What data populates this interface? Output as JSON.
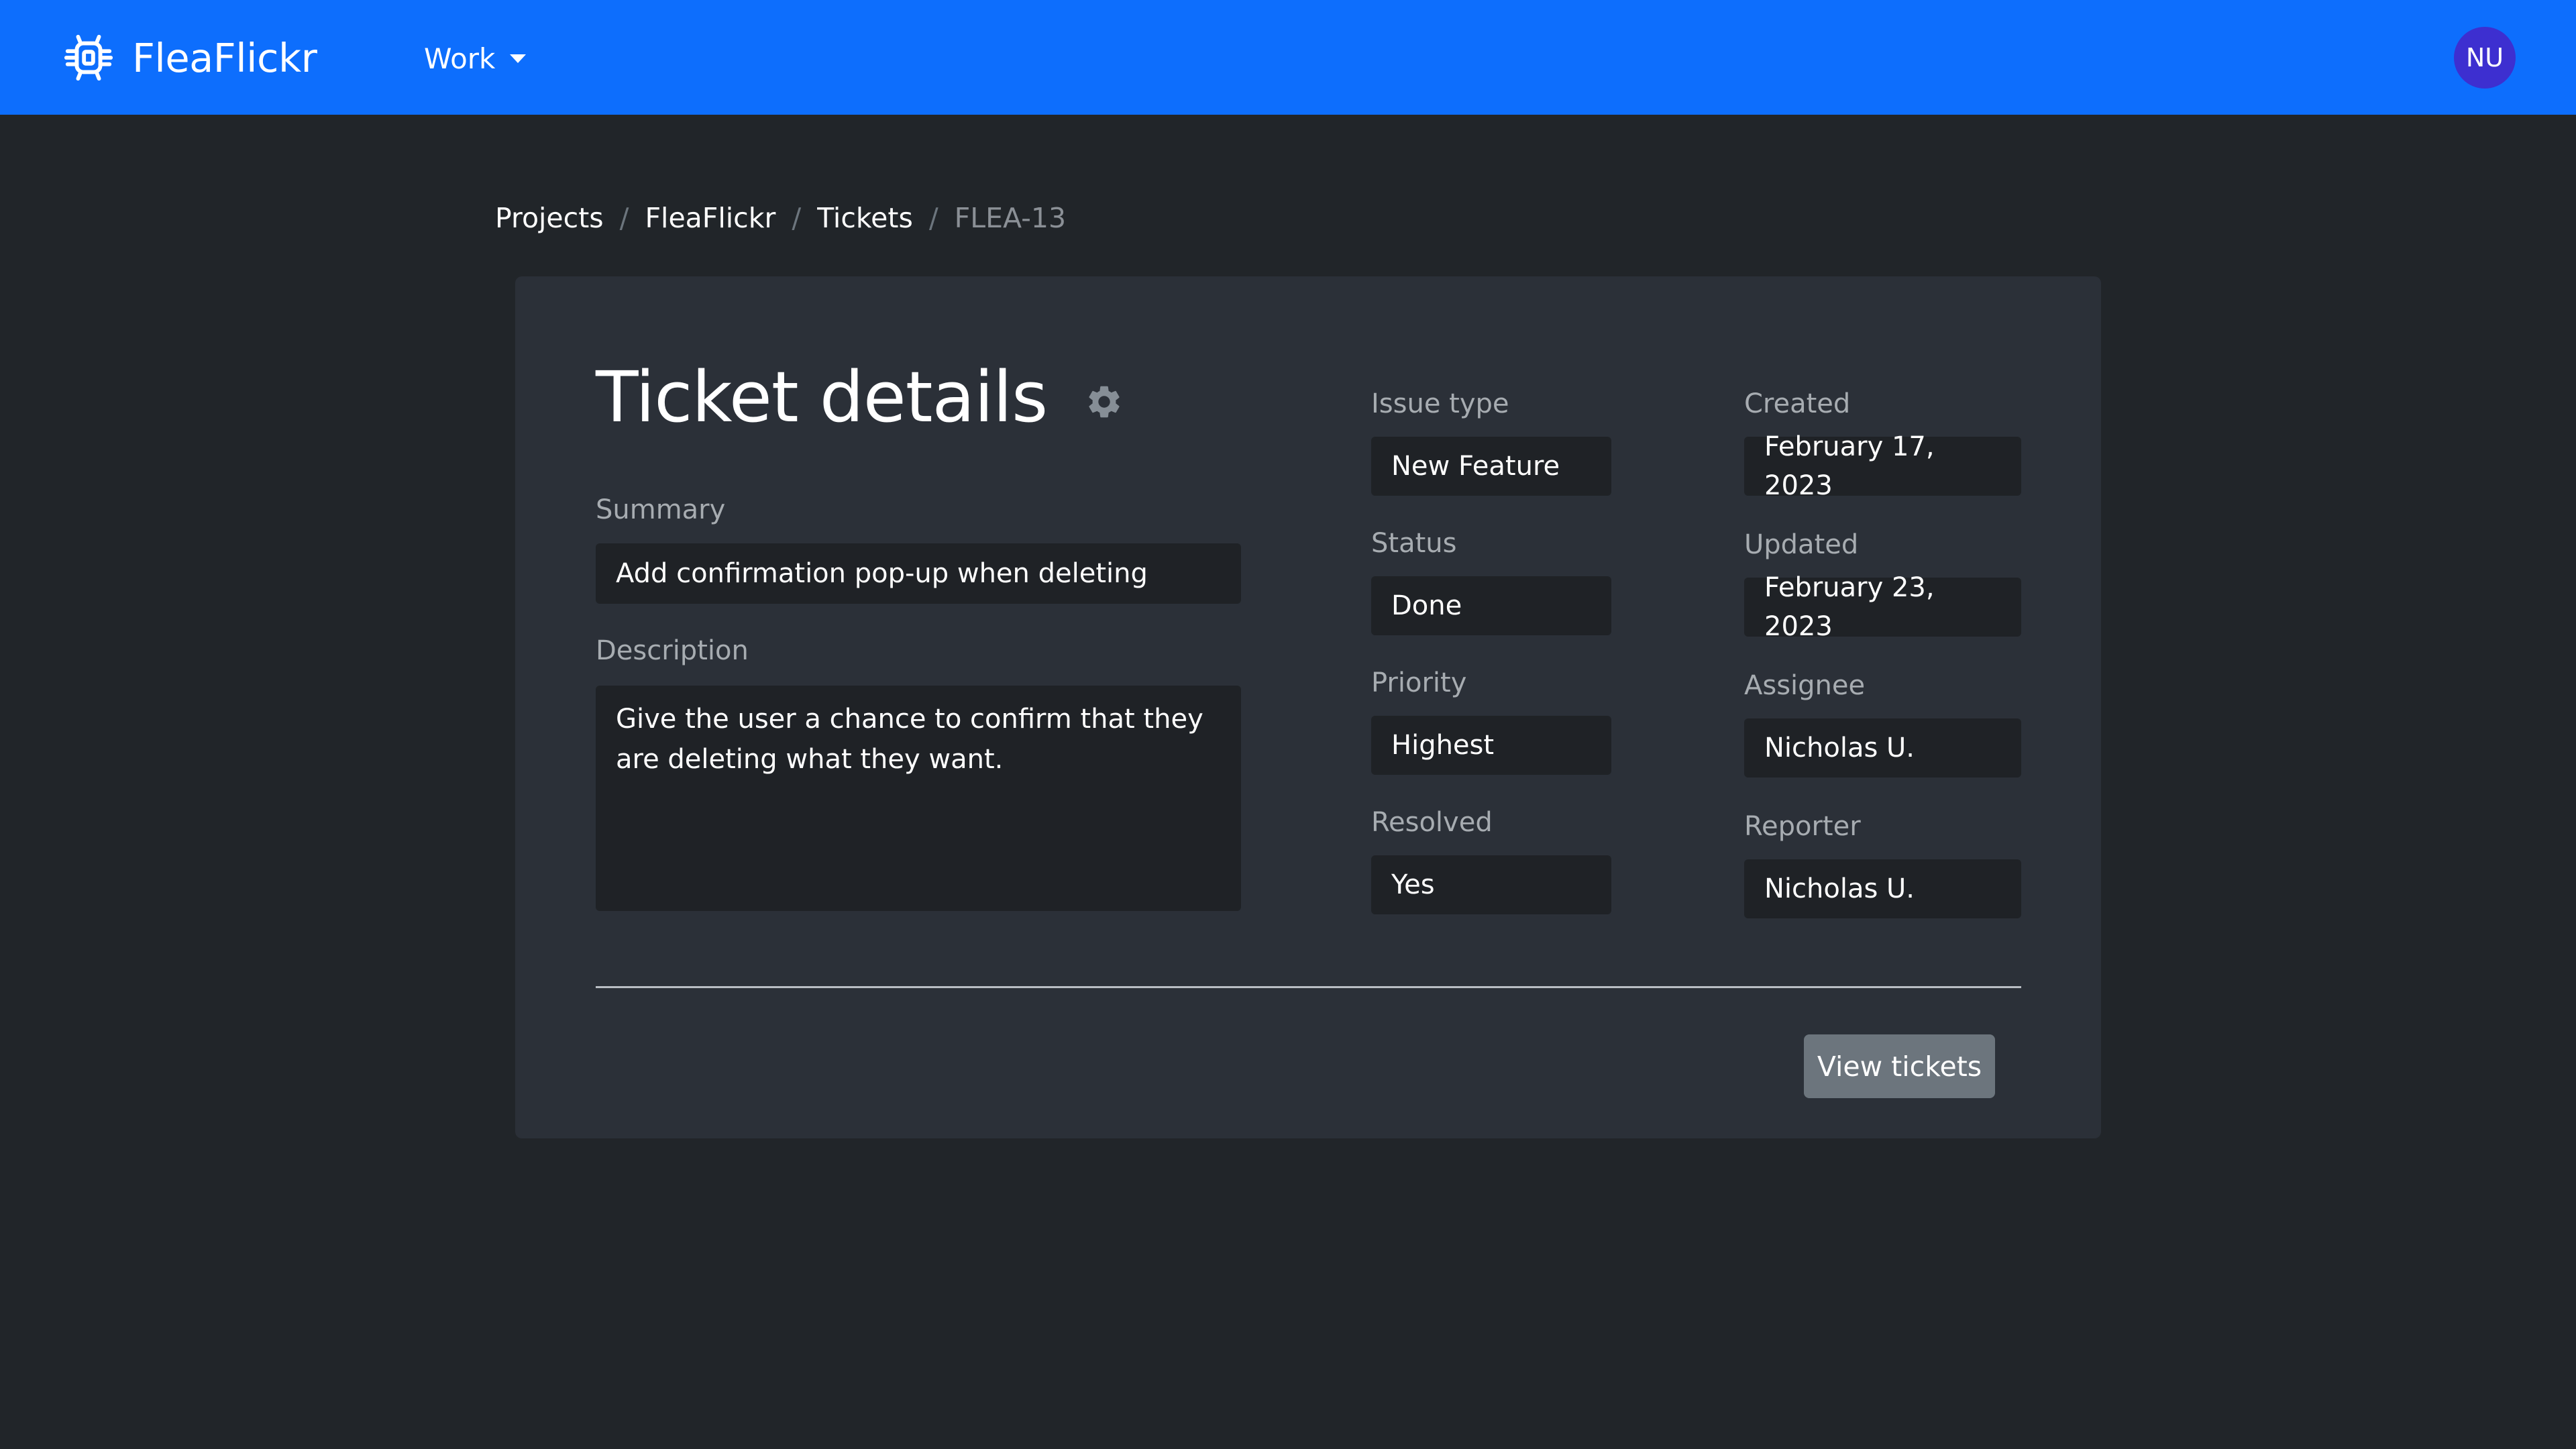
{
  "navbar": {
    "brand": "FleaFlickr",
    "brand_icon": "bug-icon",
    "work_menu": "Work",
    "avatar_initials": "NU",
    "color": "#0d6efd"
  },
  "breadcrumb": {
    "items": [
      "Projects",
      "FleaFlickr",
      "Tickets"
    ],
    "active": "FLEA-13",
    "separator": "/"
  },
  "ticket": {
    "title": "Ticket details",
    "settings_icon": "gear-icon",
    "summary_label": "Summary",
    "summary": "Add confirmation pop-up when deleting",
    "description_label": "Description",
    "description": "Give the user a chance to confirm that they are deleting what they want.",
    "issue_type_label": "Issue type",
    "issue_type": "New Feature",
    "status_label": "Status",
    "status": "Done",
    "priority_label": "Priority",
    "priority": "Highest",
    "resolved_label": "Resolved",
    "resolved": "Yes",
    "created_label": "Created",
    "created": "February 17, 2023",
    "updated_label": "Updated",
    "updated": "February 23, 2023",
    "assignee_label": "Assignee",
    "assignee": "Nicholas U.",
    "reporter_label": "Reporter",
    "reporter": "Nicholas U.",
    "view_tickets_button": "View tickets"
  }
}
